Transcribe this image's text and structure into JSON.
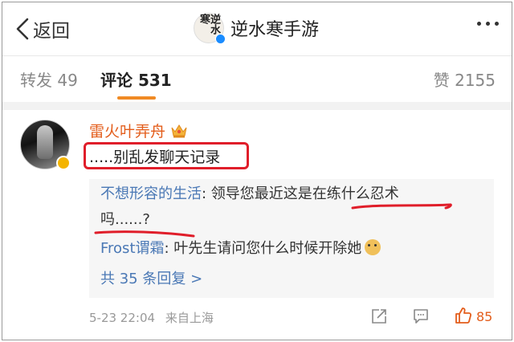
{
  "header": {
    "back_label": "返回",
    "title": "逆水寒手游",
    "avatar_glyph": "逆水寒"
  },
  "tabs": [
    {
      "label": "转发 49"
    },
    {
      "label": "评论 531"
    },
    {
      "label": "赞 2155"
    }
  ],
  "comment": {
    "username": "雷火叶弄舟",
    "text": ".....别乱发聊天记录",
    "replies": [
      {
        "user": "不想形容的生活",
        "separator": ":",
        "text_a": " 领导您最近这是",
        "text_b": "在练什么忍术",
        "text_c": "吗......?"
      },
      {
        "user": "Frost谓霜",
        "separator": ":",
        "text": " 叶先生请问您什么时候开除她"
      }
    ],
    "more_replies": "共 35 条回复 >",
    "timestamp": "5-23 22:04",
    "location": "来自上海",
    "like_count": "85"
  },
  "colors": {
    "accent_orange": "#e35d1b",
    "link_blue": "#4a78b5",
    "annotation_red": "#e01e2a",
    "tab_indicator": "#f08a24"
  }
}
